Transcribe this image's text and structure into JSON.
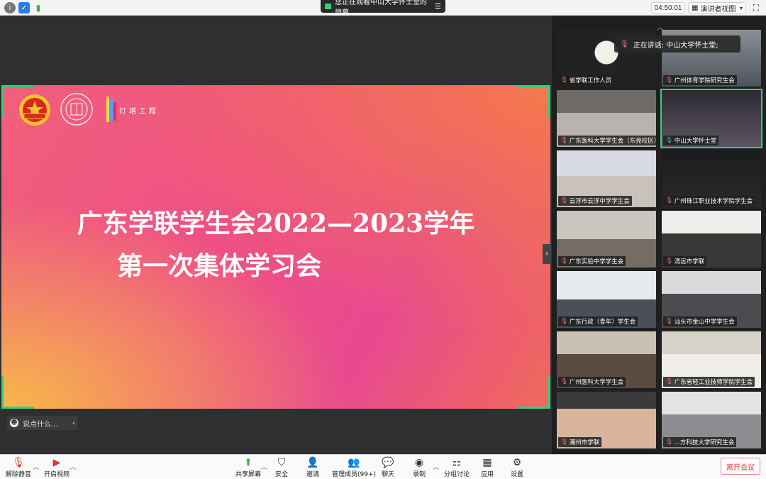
{
  "topbar": {
    "share_banner": "您正在观看中山大学怀士堂的屏幕",
    "timer": "04:50:01",
    "view_button": "演讲者视图"
  },
  "slide": {
    "title_line1": "广东学联学生会2022—2023学年",
    "title_line2": "第一次集体学习会",
    "logo_text": "灯塔工程"
  },
  "chat": {
    "placeholder": "说点什么..."
  },
  "speaking": {
    "label": "正在讲话: 中山大学怀士堂;"
  },
  "participants": [
    "省学联工作人员",
    "广州体育学院研究生会",
    "广东医科大学学生会（东莞校区）",
    "中山大学怀士堂",
    "云浮市云浮中学学生会",
    "广州珠江职业技术学院学生会",
    "广东实验中学学生会",
    "清远市学联",
    "广东行政（青年）学生会",
    "汕头市金山中学学生会",
    "广州医科大学学生会",
    "广东省轻工业技师学院学生会",
    "潮州市学联",
    "...方科技大学研究生会"
  ],
  "toolbar": {
    "unmute": "解除静音",
    "video": "开启视频",
    "share": "共享屏幕",
    "security": "安全",
    "invite": "邀请",
    "members": "管理成员(99+)",
    "chat": "聊天",
    "record": "录制",
    "breakout": "分组讨论",
    "apps": "应用",
    "settings": "设置",
    "leave": "离开会议"
  }
}
